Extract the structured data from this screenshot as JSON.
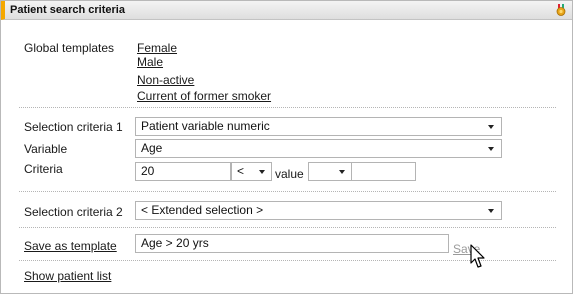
{
  "panel": {
    "title": "Patient search criteria"
  },
  "templates": {
    "label": "Global templates",
    "links": [
      "Female",
      "Male",
      "Non-active",
      "Current of former smoker"
    ]
  },
  "criteria1": {
    "label": "Selection criteria 1",
    "value": "Patient variable numeric"
  },
  "variable": {
    "label": "Variable",
    "value": "Age"
  },
  "criteria": {
    "label": "Criteria",
    "input_value": "20",
    "operator": "<",
    "value_label": "value",
    "value_select": "",
    "value_input": ""
  },
  "criteria2": {
    "label": "Selection criteria 2",
    "value": "< Extended selection >"
  },
  "save_template": {
    "link": "Save as template",
    "input_value": "Age > 20 yrs",
    "save_label": "Save"
  },
  "show_list": {
    "link": "Show patient list"
  },
  "colors": {
    "accent": "#f5a800",
    "title_bg": "#e6e6e6",
    "border": "#b4b4b4"
  },
  "icons": {
    "corner": "medal-icon",
    "cursor": "mouse-pointer-icon"
  }
}
